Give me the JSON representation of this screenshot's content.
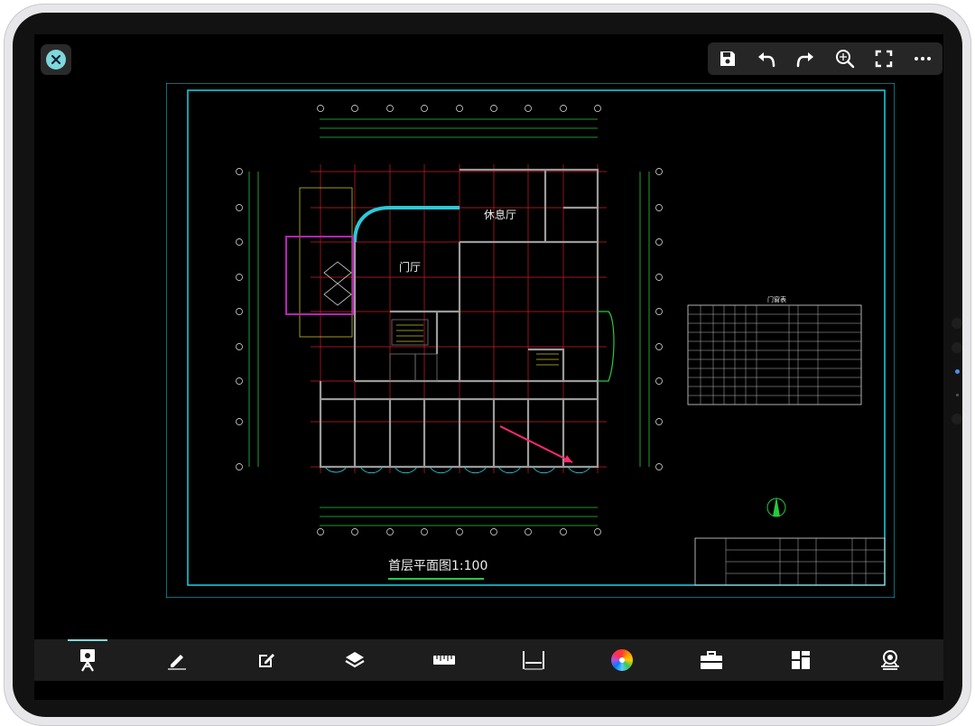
{
  "drawing": {
    "title": "首层平面图1:100",
    "room_labels": {
      "lounge": "休息厅",
      "lobby": "门厅",
      "table_title": "门窗表"
    }
  },
  "toolbar_top": {
    "icons": [
      "save-icon",
      "undo-icon",
      "redo-icon",
      "zoom-extents-icon",
      "fullscreen-icon",
      "more-icon"
    ]
  },
  "toolbar_bottom": {
    "icons": [
      "view-mode-icon",
      "pencil-icon",
      "edit-note-icon",
      "layers-icon",
      "measure-icon",
      "dimension-icon",
      "color-wheel-icon",
      "toolbox-icon",
      "layout-icon",
      "cloud-icon"
    ],
    "active_index": 0
  },
  "colors": {
    "accent": "#7fd8db",
    "frame": "#17d6e6",
    "grid": "#d11b2a",
    "dimension": "#27c93f",
    "text_yellow": "#d7d15a",
    "arrow": "#ff2a6d"
  }
}
